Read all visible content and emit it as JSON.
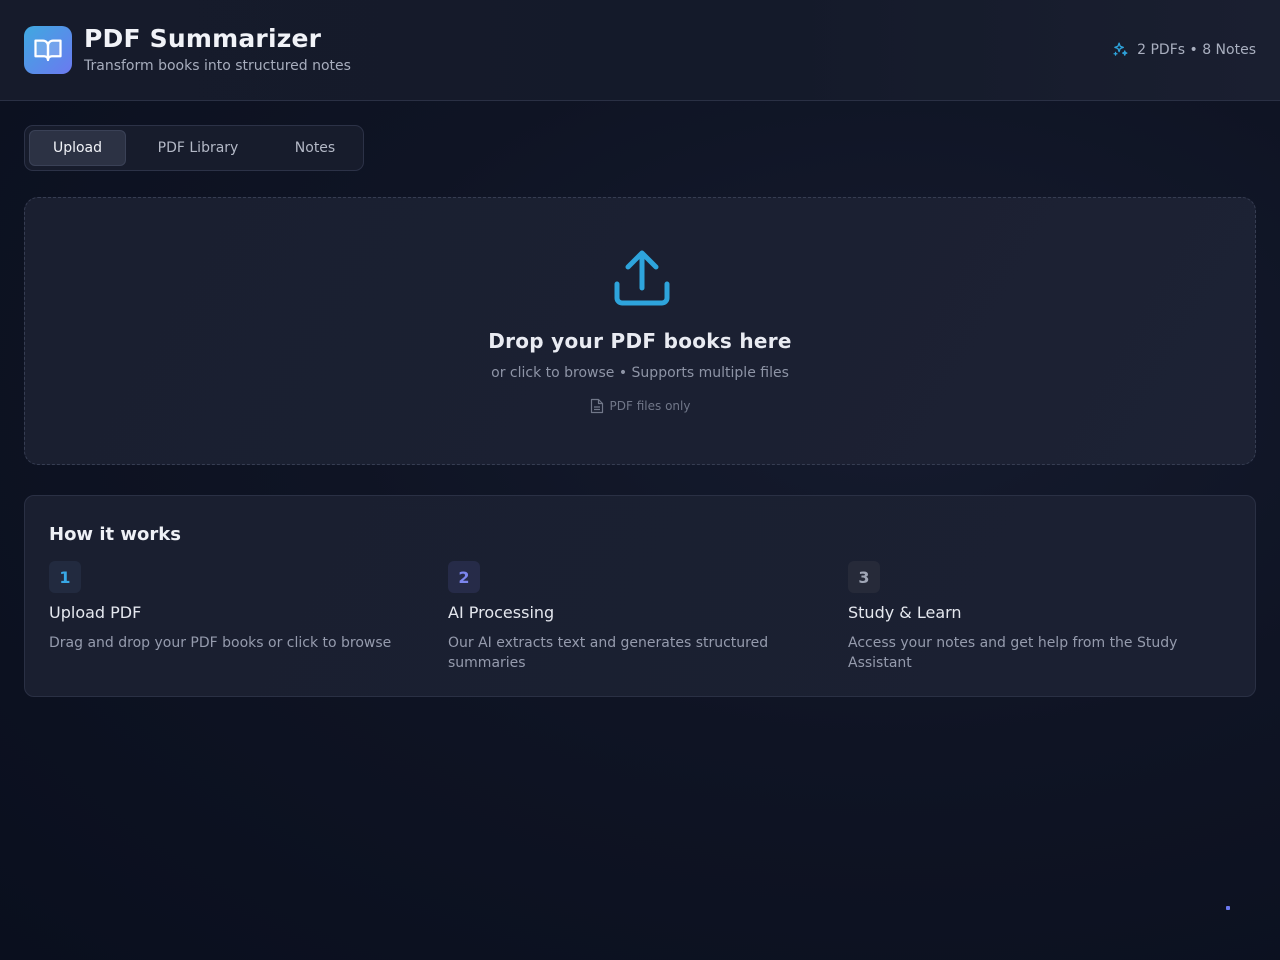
{
  "header": {
    "title": "PDF Summarizer",
    "subtitle": "Transform books into structured notes",
    "logo_icon": "book-open-icon",
    "stats_icon": "sparkles-icon",
    "stats": "2 PDFs • 8 Notes"
  },
  "tabs": [
    {
      "label": "Upload",
      "active": true
    },
    {
      "label": "PDF Library",
      "active": false
    },
    {
      "label": "Notes",
      "active": false
    }
  ],
  "dropzone": {
    "icon": "upload-icon",
    "title": "Drop your PDF books here",
    "subtitle": "or click to browse • Supports multiple files",
    "hint_icon": "file-icon",
    "hint": "PDF files only"
  },
  "how_it_works": {
    "title": "How it works",
    "steps": [
      {
        "number": "1",
        "title": "Upload PDF",
        "description": "Drag and drop your PDF books or click to browse",
        "color": "#38a8e6",
        "bg": "#222a3f"
      },
      {
        "number": "2",
        "title": "AI Processing",
        "description": "Our AI extracts text and generates structured summaries",
        "color": "#7c86ee",
        "bg": "#262b48"
      },
      {
        "number": "3",
        "title": "Study & Learn",
        "description": "Access your notes and get help from the Study Assistant",
        "color": "#a0a6b6",
        "bg": "#262a39"
      }
    ]
  },
  "colors": {
    "accent": "#2ea4dc",
    "accent2": "#6b79f0",
    "background": "#0f1424"
  }
}
